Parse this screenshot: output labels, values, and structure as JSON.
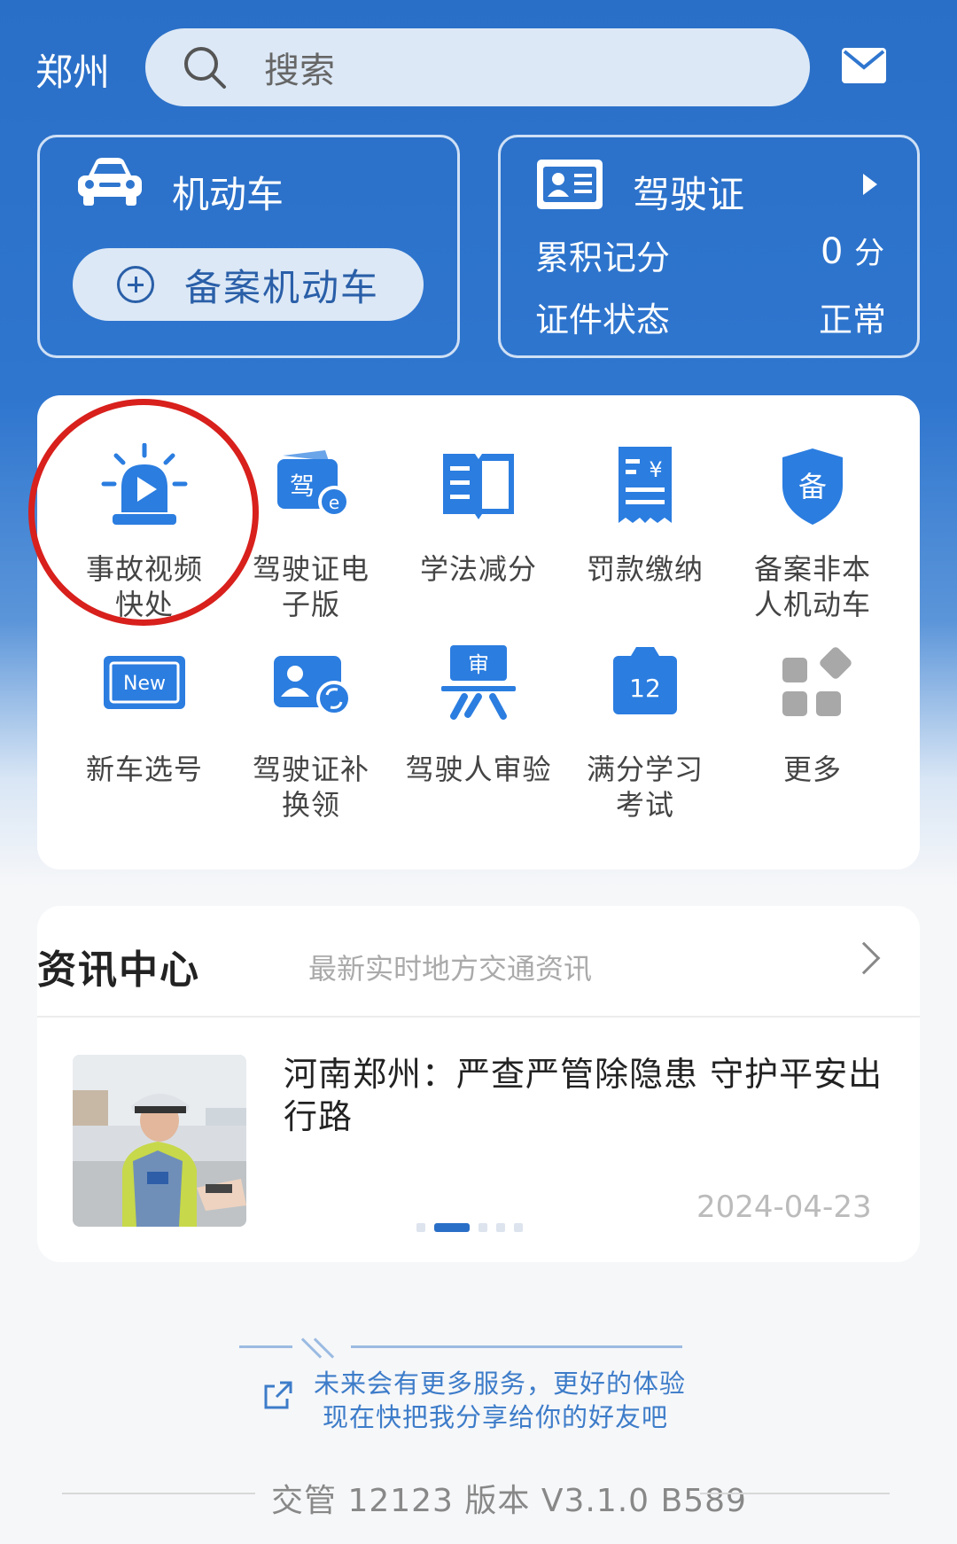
{
  "header": {
    "city": "郑州",
    "search_placeholder": "搜索",
    "icons": {
      "search": "search-icon",
      "mail": "mail-icon"
    }
  },
  "vehicle_card": {
    "title": "机动车",
    "add_button": "备案机动车"
  },
  "license_card": {
    "title": "驾驶证",
    "points_label": "累积记分",
    "points_value": "0",
    "points_unit": "分",
    "status_label": "证件状态",
    "status_value": "正常"
  },
  "services": {
    "items": [
      {
        "label_1": "事故视频",
        "label_2": "快处",
        "icon": "alarm-light-icon"
      },
      {
        "label_1": "驾驶证电",
        "label_2": "子版",
        "icon": "electronic-license-icon"
      },
      {
        "label_1": "学法减分",
        "label_2": "",
        "icon": "book-icon"
      },
      {
        "label_1": "罚款缴纳",
        "label_2": "",
        "icon": "receipt-icon"
      },
      {
        "label_1": "备案非本",
        "label_2": "人机动车",
        "icon": "shield-icon"
      },
      {
        "label_1": "新车选号",
        "label_2": "",
        "icon": "new-plate-icon"
      },
      {
        "label_1": "驾驶证补",
        "label_2": "换领",
        "icon": "license-renew-icon"
      },
      {
        "label_1": "驾驶人审验",
        "label_2": "",
        "icon": "review-icon"
      },
      {
        "label_1": "满分学习",
        "label_2": "考试",
        "icon": "calendar-12-icon"
      },
      {
        "label_1": "更多",
        "label_2": "",
        "icon": "more-grid-icon"
      }
    ],
    "badge_new": "New",
    "badge_jia": "驾",
    "badge_e": "e",
    "badge_shen": "审",
    "badge_bei": "备",
    "badge_12": "12"
  },
  "news": {
    "title": "资讯中心",
    "subtitle": "最新实时地方交通资讯",
    "article_title": "河南郑州：严查严管除隐患 守护平安出行路",
    "article_date": "2024-04-23",
    "carousel_active_index": 1
  },
  "footer": {
    "line1": "未来会有更多服务，更好的体验",
    "line2": "现在快把我分享给你的好友吧",
    "version": "交管 12123 版本 V3.1.0 B589"
  },
  "colors": {
    "primary": "#2a6fc7",
    "accent_red": "#d8201c",
    "icon_blue": "#2b7de0"
  }
}
